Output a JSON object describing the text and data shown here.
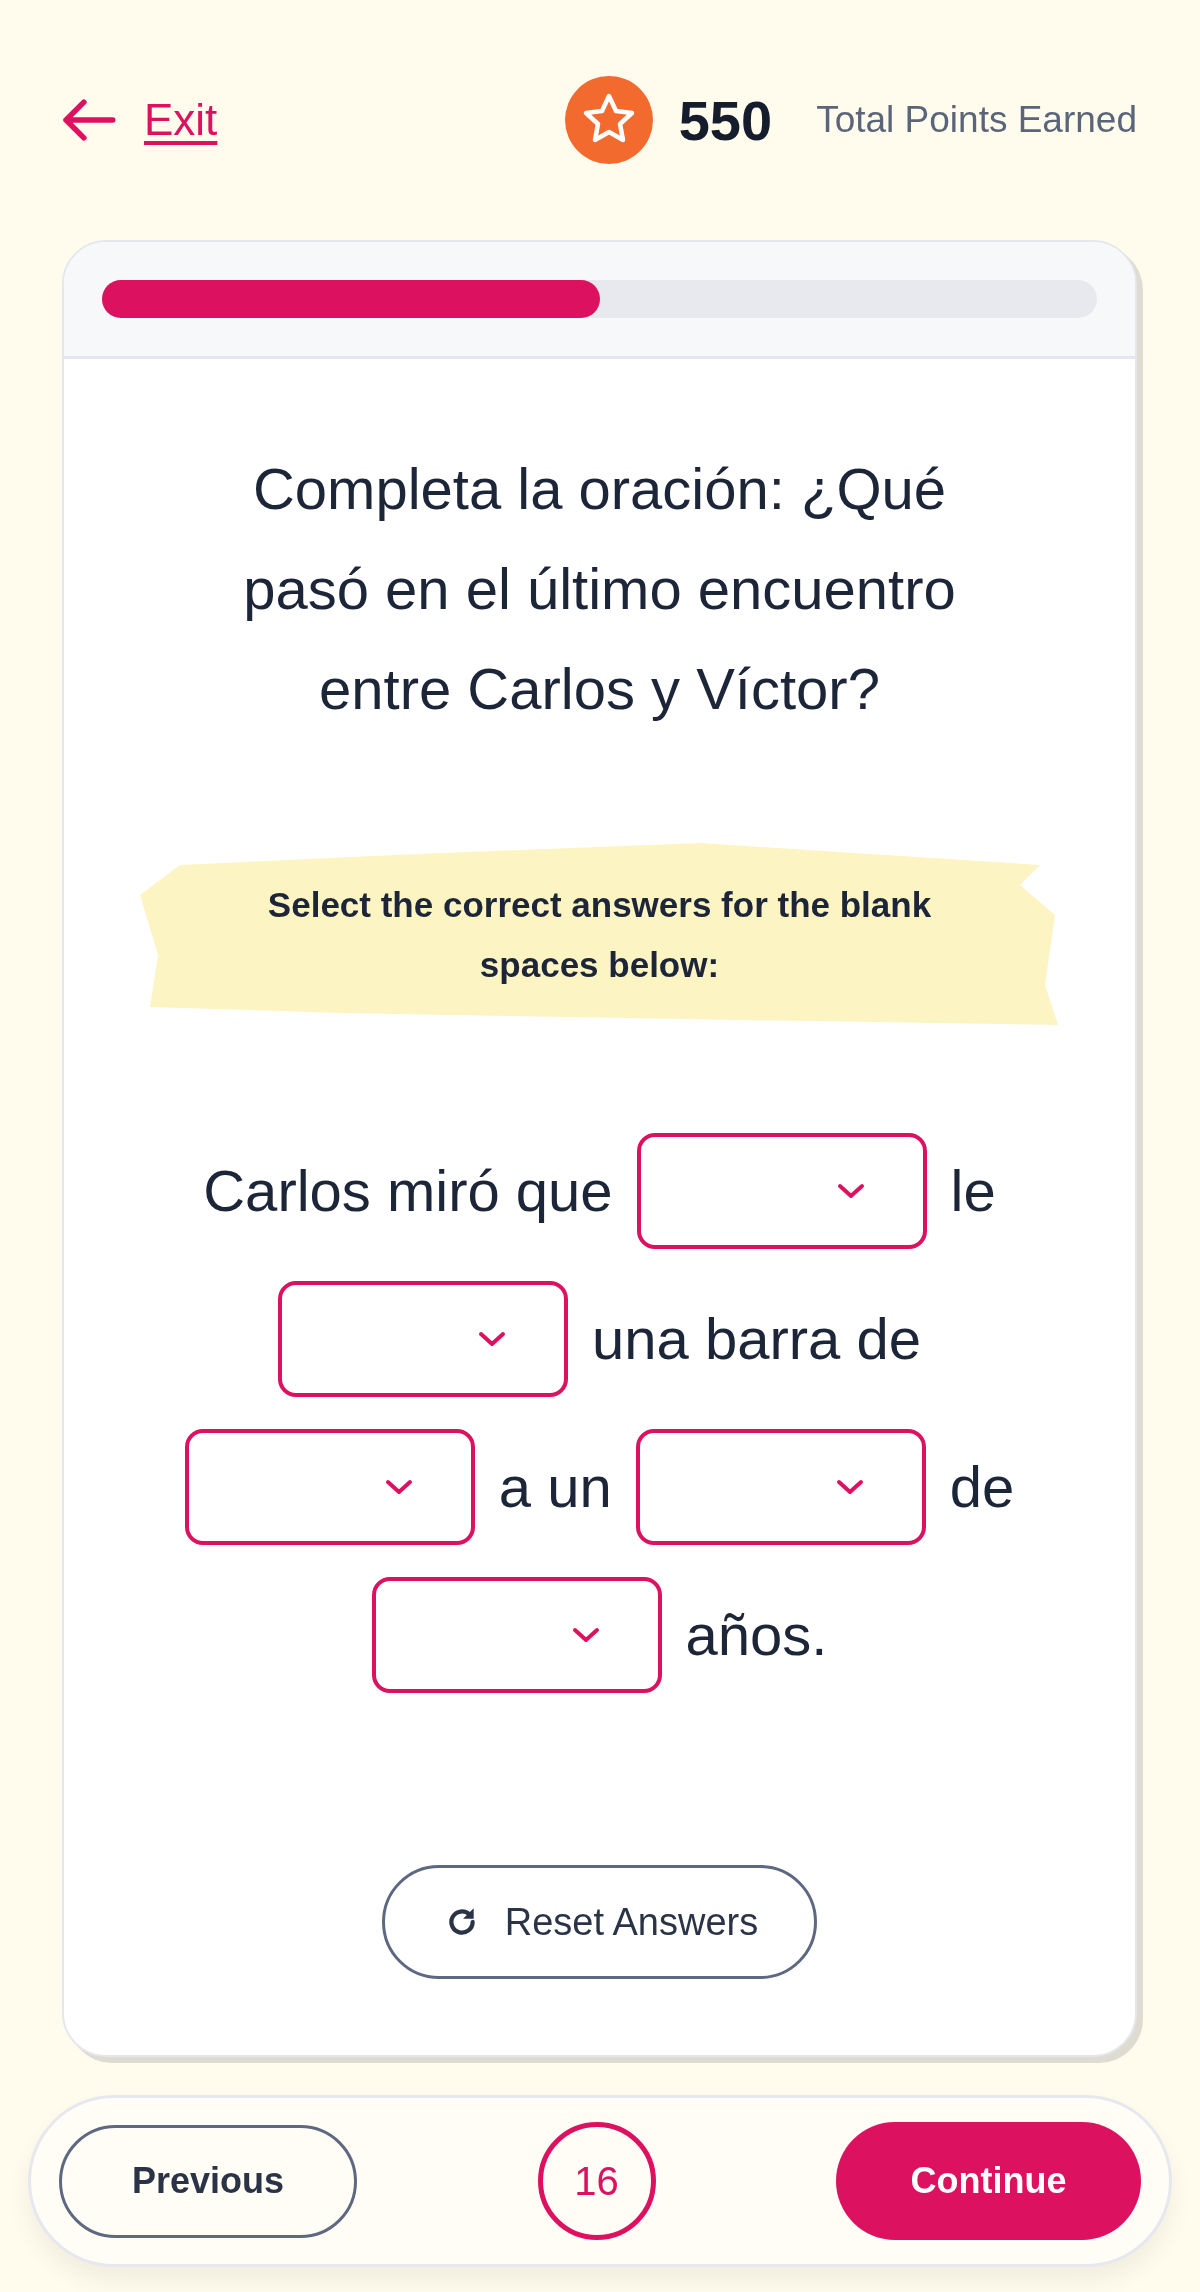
{
  "header": {
    "exit_link": "Exit",
    "points": "550",
    "points_label": "Total Points Earned"
  },
  "progress": {
    "level": 0.5
  },
  "question": "Completa la oración: ¿Qué pasó en el último encuentro entre Carlos y Víctor?",
  "instruction": "Select the correct answers for the blank spaces below:",
  "sentence": [
    {
      "kind": "text",
      "text": "Carlos miró que"
    },
    {
      "kind": "blank"
    },
    {
      "kind": "text",
      "text": "le"
    },
    {
      "kind": "blank"
    },
    {
      "kind": "text",
      "text": "una barra de"
    },
    {
      "kind": "blank"
    },
    {
      "kind": "text",
      "text": "a un"
    },
    {
      "kind": "blank"
    },
    {
      "kind": "text",
      "text": "de"
    },
    {
      "kind": "blank"
    },
    {
      "kind": "text",
      "text": "años."
    }
  ],
  "reset_button": "Reset Answers",
  "footer": {
    "previous": "Previous",
    "question_number": "16",
    "continue": "Continue"
  }
}
